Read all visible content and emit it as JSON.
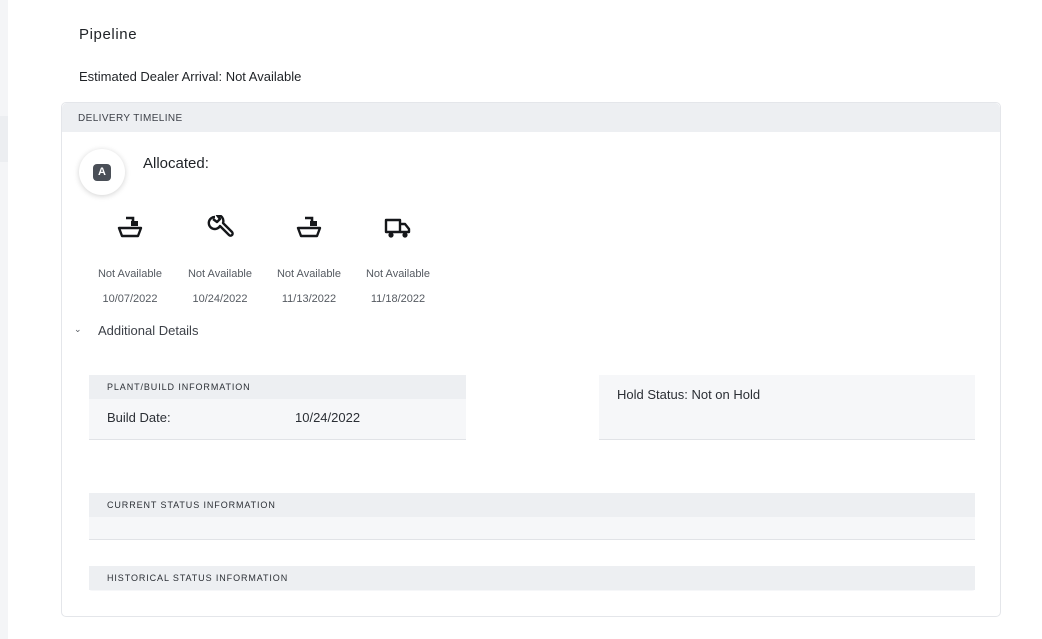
{
  "page": {
    "title": "Pipeline",
    "eta_label": "Estimated Dealer Arrival:",
    "eta_value": "Not Available"
  },
  "timeline": {
    "header": "DELIVERY TIMELINE",
    "badge_letter": "A",
    "status_label": "Allocated:",
    "steps": [
      {
        "icon": "ship-icon",
        "status": "Not Available",
        "date": "10/07/2022"
      },
      {
        "icon": "wrench-icon",
        "status": "Not Available",
        "date": "10/24/2022"
      },
      {
        "icon": "ship-icon",
        "status": "Not Available",
        "date": "11/13/2022"
      },
      {
        "icon": "truck-icon",
        "status": "Not Available",
        "date": "11/18/2022"
      }
    ]
  },
  "details": {
    "toggle_label": "Additional Details",
    "chevron_icon": "chevron-down-icon",
    "plant": {
      "header": "PLANT/BUILD INFORMATION",
      "build_date_label": "Build Date:",
      "build_date_value": "10/24/2022"
    },
    "hold": {
      "label": "Hold Status:",
      "value": "Not on Hold"
    },
    "current_status_header": "CURRENT STATUS INFORMATION",
    "historical_status_header": "HISTORICAL STATUS INFORMATION"
  }
}
